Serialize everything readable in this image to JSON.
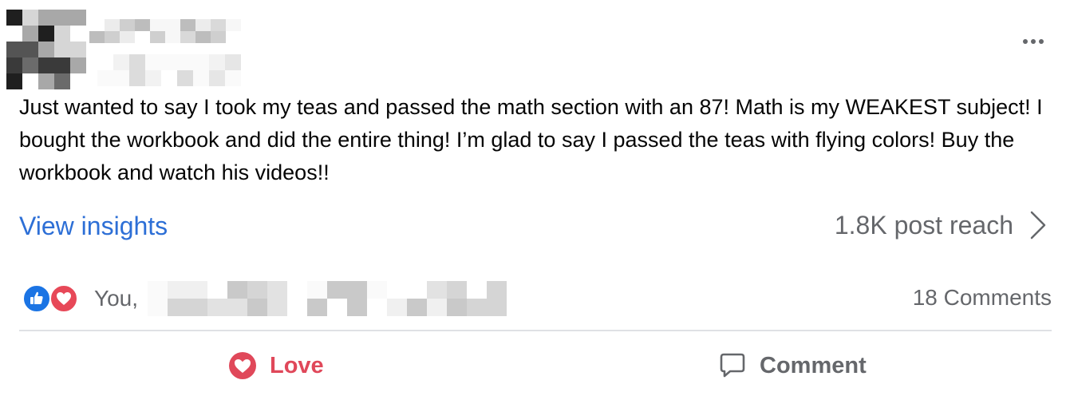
{
  "post": {
    "text": "Just wanted to say I took my teas and passed the math section with an 87! Math is my WEAKEST subject! I bought the workbook and did the entire thing! I’m glad to say I passed the teas with flying colors! Buy the workbook and watch his videos!!",
    "more_icon": "more-horizontal-icon"
  },
  "insights": {
    "link_label": "View insights",
    "reach_label": "1.8K post reach",
    "chevron_icon": "chevron-right-icon"
  },
  "reactions": {
    "icons": [
      "like-icon",
      "love-icon"
    ],
    "names_prefix": "You,",
    "comments_label": "18 Comments"
  },
  "actions": {
    "love_label": "Love",
    "comment_label": "Comment"
  },
  "colors": {
    "link_blue": "#2d6fd6",
    "like_blue": "#1b74e4",
    "love_red": "#e0485a",
    "secondary_text": "#65676b"
  }
}
